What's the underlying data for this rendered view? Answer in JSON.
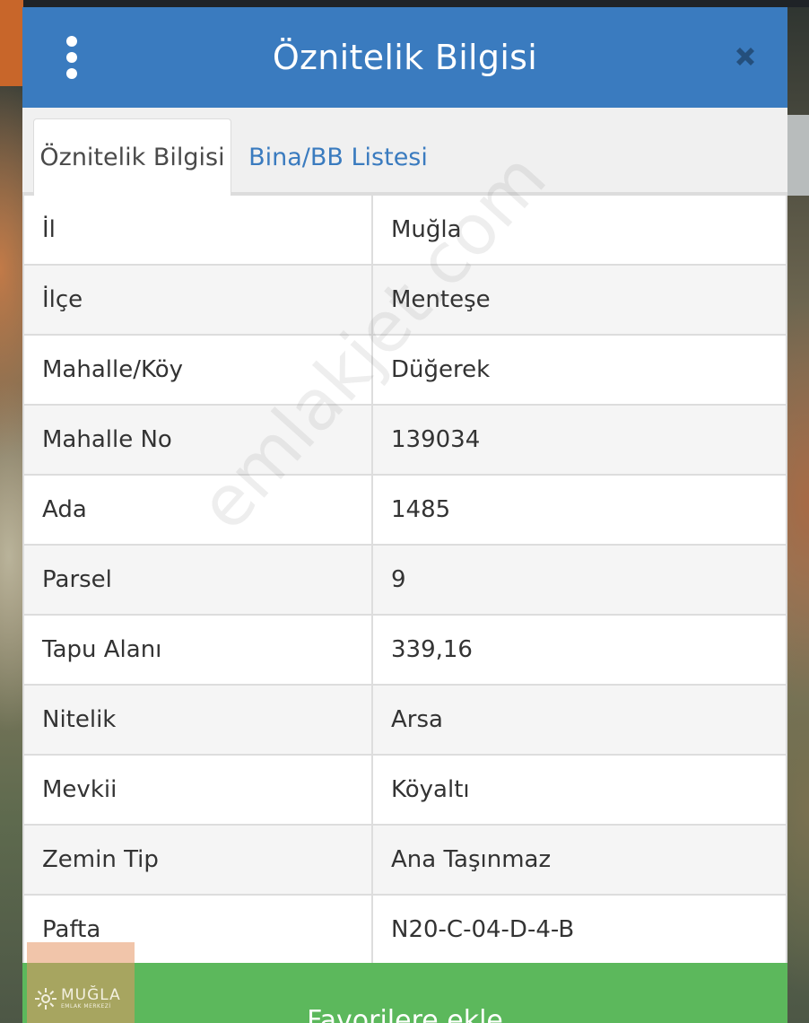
{
  "header": {
    "title": "Öznitelik Bilgisi",
    "menu_icon": "vertical-dots-icon",
    "close_icon": "close-icon"
  },
  "tabs": [
    {
      "label": "Öznitelik Bilgisi",
      "active": true
    },
    {
      "label": "Bina/BB Listesi",
      "active": false
    }
  ],
  "attributes": [
    {
      "key": "İl",
      "value": "Muğla"
    },
    {
      "key": "İlçe",
      "value": "Menteşe"
    },
    {
      "key": "Mahalle/Köy",
      "value": "Düğerek"
    },
    {
      "key": "Mahalle No",
      "value": "139034"
    },
    {
      "key": "Ada",
      "value": "1485"
    },
    {
      "key": "Parsel",
      "value": "9"
    },
    {
      "key": "Tapu Alanı",
      "value": "339,16"
    },
    {
      "key": "Nitelik",
      "value": "Arsa"
    },
    {
      "key": "Mevkii",
      "value": "Köyaltı"
    },
    {
      "key": "Zemin Tip",
      "value": "Ana Taşınmaz"
    },
    {
      "key": "Pafta",
      "value": "N20-C-04-D-4-B"
    }
  ],
  "footer": {
    "favorite_label": "Favorilere ekle"
  },
  "watermark": "emlakjet.com",
  "logo": {
    "name": "MUĞLA",
    "subtitle": "EMLAK MERKEZİ"
  },
  "colors": {
    "header_bg": "#3a7bbf",
    "tab_link": "#3a7bbf",
    "favorite_bg": "#5cb85c"
  }
}
